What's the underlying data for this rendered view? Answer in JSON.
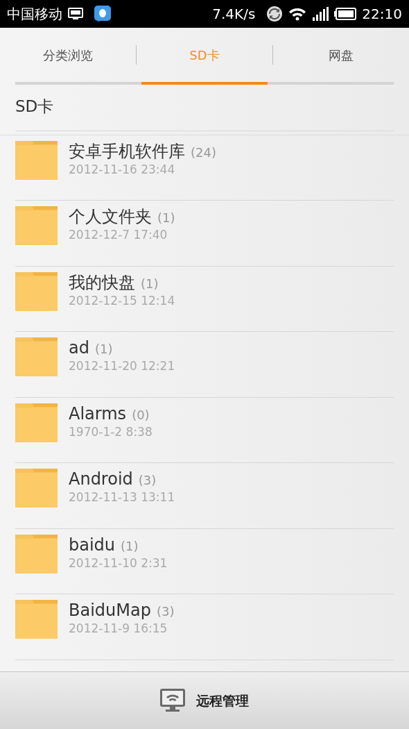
{
  "status_bar": {
    "carrier": "中国移动",
    "speed": "7.4K/s",
    "time": "22:10"
  },
  "tabs": [
    {
      "label": "分类浏览",
      "selected": false
    },
    {
      "label": "SD卡",
      "selected": true
    },
    {
      "label": "网盘",
      "selected": false
    }
  ],
  "path": "SD卡",
  "folders": [
    {
      "name": "安卓手机软件库",
      "count": "(24)",
      "date": "2012-11-16 23:44"
    },
    {
      "name": "个人文件夹",
      "count": "(1)",
      "date": "2012-12-7 17:40"
    },
    {
      "name": "我的快盘",
      "count": "(1)",
      "date": "2012-12-15 12:14"
    },
    {
      "name": "ad",
      "count": "(1)",
      "date": "2012-11-20 12:21"
    },
    {
      "name": "Alarms",
      "count": "(0)",
      "date": "1970-1-2 8:38"
    },
    {
      "name": "Android",
      "count": "(3)",
      "date": "2012-11-13 13:11"
    },
    {
      "name": "baidu",
      "count": "(1)",
      "date": "2012-11-10 2:31"
    },
    {
      "name": "BaiduMap",
      "count": "(3)",
      "date": "2012-11-9 16:15"
    }
  ],
  "bottom_button": {
    "label": "远程管理"
  }
}
